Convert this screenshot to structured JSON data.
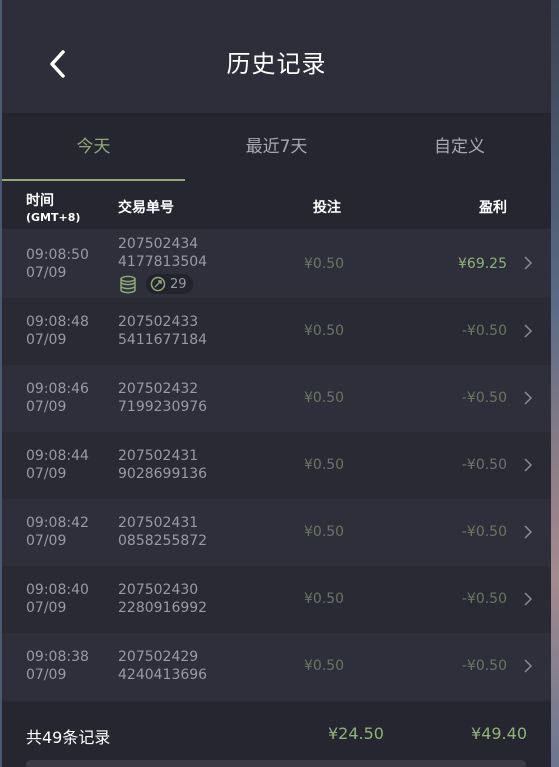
{
  "header": {
    "title": "历史记录"
  },
  "tabs": [
    {
      "label": "今天",
      "active": true
    },
    {
      "label": "最近7天",
      "active": false
    },
    {
      "label": "自定义",
      "active": false
    }
  ],
  "columns": {
    "time": "时间",
    "time_zone": "(GMT+8)",
    "order": "交易单号",
    "bet": "投注",
    "profit": "盈利"
  },
  "rows": [
    {
      "time": "09:08:50",
      "date": "07/09",
      "order_a": "207502434",
      "order_b": "4177813504",
      "bet": "¥0.50",
      "profit": "¥69.25",
      "win": true,
      "count": "29"
    },
    {
      "time": "09:08:48",
      "date": "07/09",
      "order_a": "207502433",
      "order_b": "5411677184",
      "bet": "¥0.50",
      "profit": "-¥0.50",
      "win": false
    },
    {
      "time": "09:08:46",
      "date": "07/09",
      "order_a": "207502432",
      "order_b": "7199230976",
      "bet": "¥0.50",
      "profit": "-¥0.50",
      "win": false
    },
    {
      "time": "09:08:44",
      "date": "07/09",
      "order_a": "207502431",
      "order_b": "9028699136",
      "bet": "¥0.50",
      "profit": "-¥0.50",
      "win": false
    },
    {
      "time": "09:08:42",
      "date": "07/09",
      "order_a": "207502431",
      "order_b": "0858255872",
      "bet": "¥0.50",
      "profit": "-¥0.50",
      "win": false
    },
    {
      "time": "09:08:40",
      "date": "07/09",
      "order_a": "207502430",
      "order_b": "2280916992",
      "bet": "¥0.50",
      "profit": "-¥0.50",
      "win": false
    },
    {
      "time": "09:08:38",
      "date": "07/09",
      "order_a": "207502429",
      "order_b": "4240413696",
      "bet": "¥0.50",
      "profit": "-¥0.50",
      "win": false
    }
  ],
  "footer": {
    "total_label": "共49条记录",
    "total_bet": "¥24.50",
    "total_profit": "¥49.40"
  },
  "colors": {
    "accent": "#8fa97a",
    "win": "#8fb37a",
    "background": "#2b2b36"
  }
}
